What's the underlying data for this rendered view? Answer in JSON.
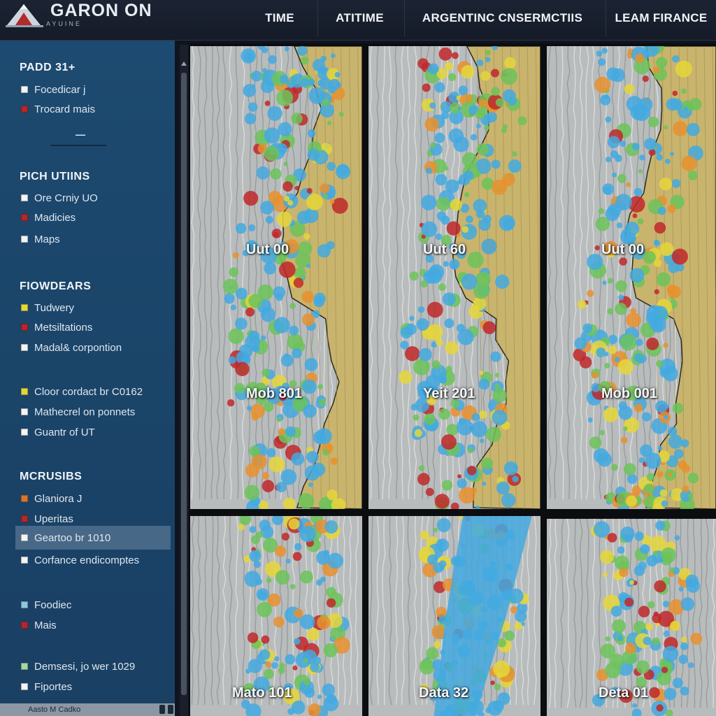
{
  "header": {
    "brand": "GARON ON",
    "brand_sub": "AYUINE",
    "nav": [
      "TIME",
      "ATITIME",
      "ARGENTINC CNSERMCTIIS",
      "LEAM FIRANCE"
    ]
  },
  "sidebar": {
    "sections": [
      {
        "title": "PADD 31+",
        "items": [
          {
            "label": "Focedicar j",
            "swatch": "#f4f4f4"
          },
          {
            "label": "Trocard mais",
            "swatch": "#b3282d"
          }
        ]
      },
      {
        "title": "PICH UTIINS",
        "items": [
          {
            "label": "Ore Crniy UO",
            "swatch": "#f4f4f4"
          },
          {
            "label": "Madicies",
            "swatch": "#b3282d"
          },
          {
            "label": "Maps",
            "swatch": "#f4f4f4"
          }
        ]
      },
      {
        "title": "FIOWDEARS",
        "items": [
          {
            "label": "Tudwery",
            "swatch": "#e5d63a"
          },
          {
            "label": "Metsiltations",
            "swatch": "#b3282d"
          },
          {
            "label": "Madal& corpontion",
            "swatch": "#f4f4f4"
          }
        ]
      },
      {
        "title": "",
        "items": [
          {
            "label": "Cloor cordact br C0162",
            "swatch": "#e5d63a"
          },
          {
            "label": "Mathecrel on ponnets",
            "swatch": "#f4f4f4"
          },
          {
            "label": "Guantr of UT",
            "swatch": "#f4f4f4"
          }
        ]
      },
      {
        "title": "MCRUSIBS",
        "items": [
          {
            "label": "Glaniora J",
            "swatch": "#d4772e"
          },
          {
            "label": "Uperitas",
            "swatch": "#b3282d"
          },
          {
            "label": "Geartoo br 1010",
            "swatch": "#f4f4f4",
            "selected": true
          },
          {
            "label": "Corfance endicomptes",
            "swatch": "#f4f4f4"
          }
        ]
      },
      {
        "title": "",
        "items": [
          {
            "label": "Foodiec",
            "swatch": "#8ec9dc"
          },
          {
            "label": "Mais",
            "swatch": "#b3282d"
          }
        ]
      },
      {
        "title": "",
        "items": [
          {
            "label": "Demsesi, jo wer 1029",
            "swatch": "#a8d8a0"
          },
          {
            "label": "Fiportes",
            "swatch": "#f4f4f4"
          }
        ]
      }
    ],
    "divider_text": "—",
    "footer": "Aasto M Cadko"
  },
  "panels": [
    {
      "label_top": "Uut 00",
      "label_bottom": "Mob 801",
      "terrain_fraction": 0.4,
      "seed": 3
    },
    {
      "label_top": "Uut 60",
      "label_bottom": "Yeit 201",
      "terrain_fraction": 0.45,
      "seed": 7
    },
    {
      "label_top": "Uut 00",
      "label_bottom": "Mob 001",
      "terrain_fraction": 0.45,
      "seed": 11
    },
    {
      "label_top": "",
      "label_bottom": "Mato 101",
      "terrain_fraction": 0,
      "seed": 17
    },
    {
      "label_top": "",
      "label_bottom": "Data 32",
      "terrain_fraction": 0,
      "seed": 23
    },
    {
      "label_top": "",
      "label_bottom": "Deta 01",
      "terrain_fraction": 0,
      "seed": 29
    }
  ],
  "colors": {
    "sidebar_bg": "#1d4a70",
    "header_bg": "#1a2030",
    "terrain": "#c9b46e",
    "map_gray": "#b9bcbc",
    "heat_blue": "#43a9e0",
    "heat_green": "#6cc35a",
    "heat_yellow": "#e5d63a",
    "heat_orange": "#e8902e",
    "heat_red": "#c0282a"
  }
}
